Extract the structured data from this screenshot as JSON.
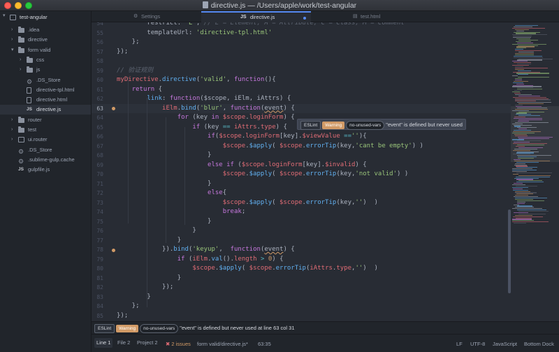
{
  "window": {
    "title": "directive.js — /Users/apple/work/test-angular"
  },
  "tree": {
    "root": "test-angular",
    "items": [
      {
        "label": ".idea",
        "type": "folder",
        "depth": 1,
        "expanded": false
      },
      {
        "label": "directive",
        "type": "folder",
        "depth": 1,
        "expanded": false
      },
      {
        "label": "form valid",
        "type": "folder",
        "depth": 1,
        "expanded": true
      },
      {
        "label": "css",
        "type": "folder",
        "depth": 2,
        "expanded": false
      },
      {
        "label": "js",
        "type": "folder",
        "depth": 2,
        "expanded": false
      },
      {
        "label": ".DS_Store",
        "type": "settings",
        "depth": 2
      },
      {
        "label": "directive-tpl.html",
        "type": "file",
        "depth": 2
      },
      {
        "label": "directive.html",
        "type": "file",
        "depth": 2
      },
      {
        "label": "directive.js",
        "type": "js",
        "depth": 2,
        "selected": true
      },
      {
        "label": "router",
        "type": "folder",
        "depth": 1,
        "expanded": false
      },
      {
        "label": "test",
        "type": "folder",
        "depth": 1,
        "expanded": false
      },
      {
        "label": "ui.router",
        "type": "repo",
        "depth": 1,
        "expanded": false
      },
      {
        "label": ".DS_Store",
        "type": "settings",
        "depth": 1
      },
      {
        "label": ".sublime-gulp.cache",
        "type": "settings",
        "depth": 1
      },
      {
        "label": "gulpfile.js",
        "type": "js",
        "depth": 1
      }
    ]
  },
  "tabs": [
    {
      "label": "Settings",
      "icon": "gear-icon",
      "active": false
    },
    {
      "label": "directive.js",
      "icon": "js-icon",
      "active": true,
      "modified": true
    },
    {
      "label": "test.html",
      "icon": "file-icon",
      "active": false
    }
  ],
  "editor": {
    "current_line": 63,
    "lint_lines": [
      63,
      78
    ],
    "lines": [
      {
        "n": 54,
        "tokens": [
          [
            "plain",
            "        restrict: "
          ],
          [
            "str",
            "'E'"
          ],
          [
            "plain",
            ", "
          ],
          [
            "cmt",
            "// E = Element, A = Attribute, C = Class, M = Comment"
          ]
        ]
      },
      {
        "n": 55,
        "tokens": [
          [
            "plain",
            "        templateUrl: "
          ],
          [
            "str",
            "'directive-tpl.html'"
          ]
        ]
      },
      {
        "n": 56,
        "tokens": [
          [
            "plain",
            "    };"
          ]
        ]
      },
      {
        "n": 57,
        "tokens": [
          [
            "plain",
            "});"
          ]
        ]
      },
      {
        "n": 58,
        "tokens": []
      },
      {
        "n": 59,
        "tokens": [
          [
            "cmt",
            "// 验证规则"
          ]
        ]
      },
      {
        "n": 60,
        "tokens": [
          [
            "var",
            "myDirective"
          ],
          [
            "plain",
            "."
          ],
          [
            "fn",
            "directive"
          ],
          [
            "plain",
            "("
          ],
          [
            "str",
            "'valid'"
          ],
          [
            "plain",
            ", "
          ],
          [
            "kw",
            "function"
          ],
          [
            "plain",
            "(){"
          ]
        ]
      },
      {
        "n": 61,
        "tokens": [
          [
            "plain",
            "    "
          ],
          [
            "kw",
            "return"
          ],
          [
            "plain",
            " {"
          ]
        ]
      },
      {
        "n": 62,
        "tokens": [
          [
            "plain",
            "        "
          ],
          [
            "fn",
            "link"
          ],
          [
            "plain",
            ": "
          ],
          [
            "kw",
            "function"
          ],
          [
            "plain",
            "($scope, iElm, iAttrs) {"
          ]
        ]
      },
      {
        "n": 63,
        "tokens": [
          [
            "plain",
            "            "
          ],
          [
            "var",
            "iElm"
          ],
          [
            "plain",
            "."
          ],
          [
            "fn",
            "bind"
          ],
          [
            "plain",
            "("
          ],
          [
            "str",
            "'blur'"
          ],
          [
            "plain",
            ", "
          ],
          [
            "kw",
            "function"
          ],
          [
            "plain",
            "("
          ],
          [
            "squig",
            "event"
          ],
          [
            "plain",
            ") {"
          ]
        ]
      },
      {
        "n": 64,
        "tokens": [
          [
            "plain",
            "                "
          ],
          [
            "kw",
            "for"
          ],
          [
            "plain",
            " (key "
          ],
          [
            "kw",
            "in"
          ],
          [
            "plain",
            " "
          ],
          [
            "var",
            "$scope"
          ],
          [
            "plain",
            "."
          ],
          [
            "var",
            "loginForm"
          ],
          [
            "plain",
            ") {"
          ]
        ]
      },
      {
        "n": 65,
        "tokens": [
          [
            "plain",
            "                    "
          ],
          [
            "kw",
            "if"
          ],
          [
            "plain",
            " (key "
          ],
          [
            "op",
            "=="
          ],
          [
            "plain",
            " "
          ],
          [
            "var",
            "iAttrs"
          ],
          [
            "plain",
            "."
          ],
          [
            "var",
            "type"
          ],
          [
            "plain",
            ") {"
          ]
        ]
      },
      {
        "n": 66,
        "tokens": [
          [
            "plain",
            "                        "
          ],
          [
            "kw",
            "if"
          ],
          [
            "plain",
            "("
          ],
          [
            "var",
            "$scope"
          ],
          [
            "plain",
            "."
          ],
          [
            "var",
            "loginForm"
          ],
          [
            "plain",
            "[key]."
          ],
          [
            "var",
            "$viewValue"
          ],
          [
            "plain",
            " "
          ],
          [
            "op",
            "=="
          ],
          [
            "str",
            "''"
          ],
          [
            "plain",
            "){"
          ]
        ]
      },
      {
        "n": 67,
        "tokens": [
          [
            "plain",
            "                            "
          ],
          [
            "var",
            "$scope"
          ],
          [
            "plain",
            "."
          ],
          [
            "fn",
            "$apply"
          ],
          [
            "plain",
            "( "
          ],
          [
            "var",
            "$scope"
          ],
          [
            "plain",
            "."
          ],
          [
            "fn",
            "errorTip"
          ],
          [
            "plain",
            "(key,"
          ],
          [
            "str",
            "'cant be empty'"
          ],
          [
            "plain",
            ") )"
          ]
        ]
      },
      {
        "n": 68,
        "tokens": [
          [
            "plain",
            "                        }"
          ]
        ]
      },
      {
        "n": 69,
        "tokens": [
          [
            "plain",
            "                        "
          ],
          [
            "kw",
            "else if"
          ],
          [
            "plain",
            " ("
          ],
          [
            "var",
            "$scope"
          ],
          [
            "plain",
            "."
          ],
          [
            "var",
            "loginForm"
          ],
          [
            "plain",
            "[key]."
          ],
          [
            "var",
            "$invalid"
          ],
          [
            "plain",
            ") {"
          ]
        ]
      },
      {
        "n": 70,
        "tokens": [
          [
            "plain",
            "                            "
          ],
          [
            "var",
            "$scope"
          ],
          [
            "plain",
            "."
          ],
          [
            "fn",
            "$apply"
          ],
          [
            "plain",
            "( "
          ],
          [
            "var",
            "$scope"
          ],
          [
            "plain",
            "."
          ],
          [
            "fn",
            "errorTip"
          ],
          [
            "plain",
            "(key,"
          ],
          [
            "str",
            "'not valid'"
          ],
          [
            "plain",
            ") )"
          ]
        ]
      },
      {
        "n": 71,
        "tokens": [
          [
            "plain",
            "                        }"
          ]
        ]
      },
      {
        "n": 72,
        "tokens": [
          [
            "plain",
            "                        "
          ],
          [
            "kw",
            "else"
          ],
          [
            "plain",
            "{"
          ]
        ]
      },
      {
        "n": 73,
        "tokens": [
          [
            "plain",
            "                            "
          ],
          [
            "var",
            "$scope"
          ],
          [
            "plain",
            "."
          ],
          [
            "fn",
            "$apply"
          ],
          [
            "plain",
            "( "
          ],
          [
            "var",
            "$scope"
          ],
          [
            "plain",
            "."
          ],
          [
            "fn",
            "errorTip"
          ],
          [
            "plain",
            "(key,"
          ],
          [
            "str",
            "''"
          ],
          [
            "plain",
            ")  )"
          ]
        ]
      },
      {
        "n": 74,
        "tokens": [
          [
            "plain",
            "                            "
          ],
          [
            "kw",
            "break"
          ],
          [
            "plain",
            ";"
          ]
        ]
      },
      {
        "n": 75,
        "tokens": [
          [
            "plain",
            "                        }"
          ]
        ]
      },
      {
        "n": 76,
        "tokens": [
          [
            "plain",
            "                    }"
          ]
        ]
      },
      {
        "n": 77,
        "tokens": [
          [
            "plain",
            "                }"
          ]
        ]
      },
      {
        "n": 78,
        "tokens": [
          [
            "plain",
            "            })."
          ],
          [
            "fn",
            "bind"
          ],
          [
            "plain",
            "("
          ],
          [
            "str",
            "'keyup'"
          ],
          [
            "plain",
            ",  "
          ],
          [
            "kw",
            "function"
          ],
          [
            "plain",
            "("
          ],
          [
            "squig",
            "event"
          ],
          [
            "plain",
            ") {"
          ]
        ]
      },
      {
        "n": 79,
        "tokens": [
          [
            "plain",
            "                "
          ],
          [
            "kw",
            "if"
          ],
          [
            "plain",
            " ("
          ],
          [
            "var",
            "iElm"
          ],
          [
            "plain",
            "."
          ],
          [
            "fn",
            "val"
          ],
          [
            "plain",
            "()."
          ],
          [
            "var",
            "length"
          ],
          [
            "plain",
            " "
          ],
          [
            "op",
            ">"
          ],
          [
            "plain",
            " "
          ],
          [
            "num",
            "0"
          ],
          [
            "plain",
            ") {"
          ]
        ]
      },
      {
        "n": 80,
        "tokens": [
          [
            "plain",
            "                    "
          ],
          [
            "var",
            "$scope"
          ],
          [
            "plain",
            "."
          ],
          [
            "fn",
            "$apply"
          ],
          [
            "plain",
            "( "
          ],
          [
            "var",
            "$scope"
          ],
          [
            "plain",
            "."
          ],
          [
            "fn",
            "errorTip"
          ],
          [
            "plain",
            "("
          ],
          [
            "var",
            "iAttrs"
          ],
          [
            "plain",
            "."
          ],
          [
            "var",
            "type"
          ],
          [
            "plain",
            ","
          ],
          [
            "str",
            "''"
          ],
          [
            "plain",
            ")  )"
          ]
        ]
      },
      {
        "n": 81,
        "tokens": [
          [
            "plain",
            "                }"
          ]
        ]
      },
      {
        "n": 82,
        "tokens": [
          [
            "plain",
            "            });"
          ]
        ]
      },
      {
        "n": 83,
        "tokens": [
          [
            "plain",
            "        }"
          ]
        ]
      },
      {
        "n": 84,
        "tokens": [
          [
            "plain",
            "    };"
          ]
        ]
      },
      {
        "n": 85,
        "tokens": [
          [
            "plain",
            "});"
          ]
        ]
      }
    ]
  },
  "tooltip": {
    "linter": "ESLint",
    "severity": "Warning",
    "rule": "no-unused-vars",
    "message": "\"event\" is defined but never used"
  },
  "lint_panel": {
    "linter": "ESLint",
    "severity": "Warning",
    "rule": "no-unused-vars",
    "message": "\"event\" is defined but never used",
    "location": "at line 63 col 31"
  },
  "status": {
    "tabs": [
      "Line 1",
      "File 2",
      "Project 2"
    ],
    "issues": "2 issues",
    "file": "form valid/directive.js*",
    "cursor": "63:35",
    "line_ending": "LF",
    "encoding": "UTF-8",
    "grammar": "JavaScript",
    "dock": "Bottom Dock"
  },
  "colors": {
    "accent": "#568af2",
    "warning": "#d19a66",
    "error": "#e06c75"
  }
}
